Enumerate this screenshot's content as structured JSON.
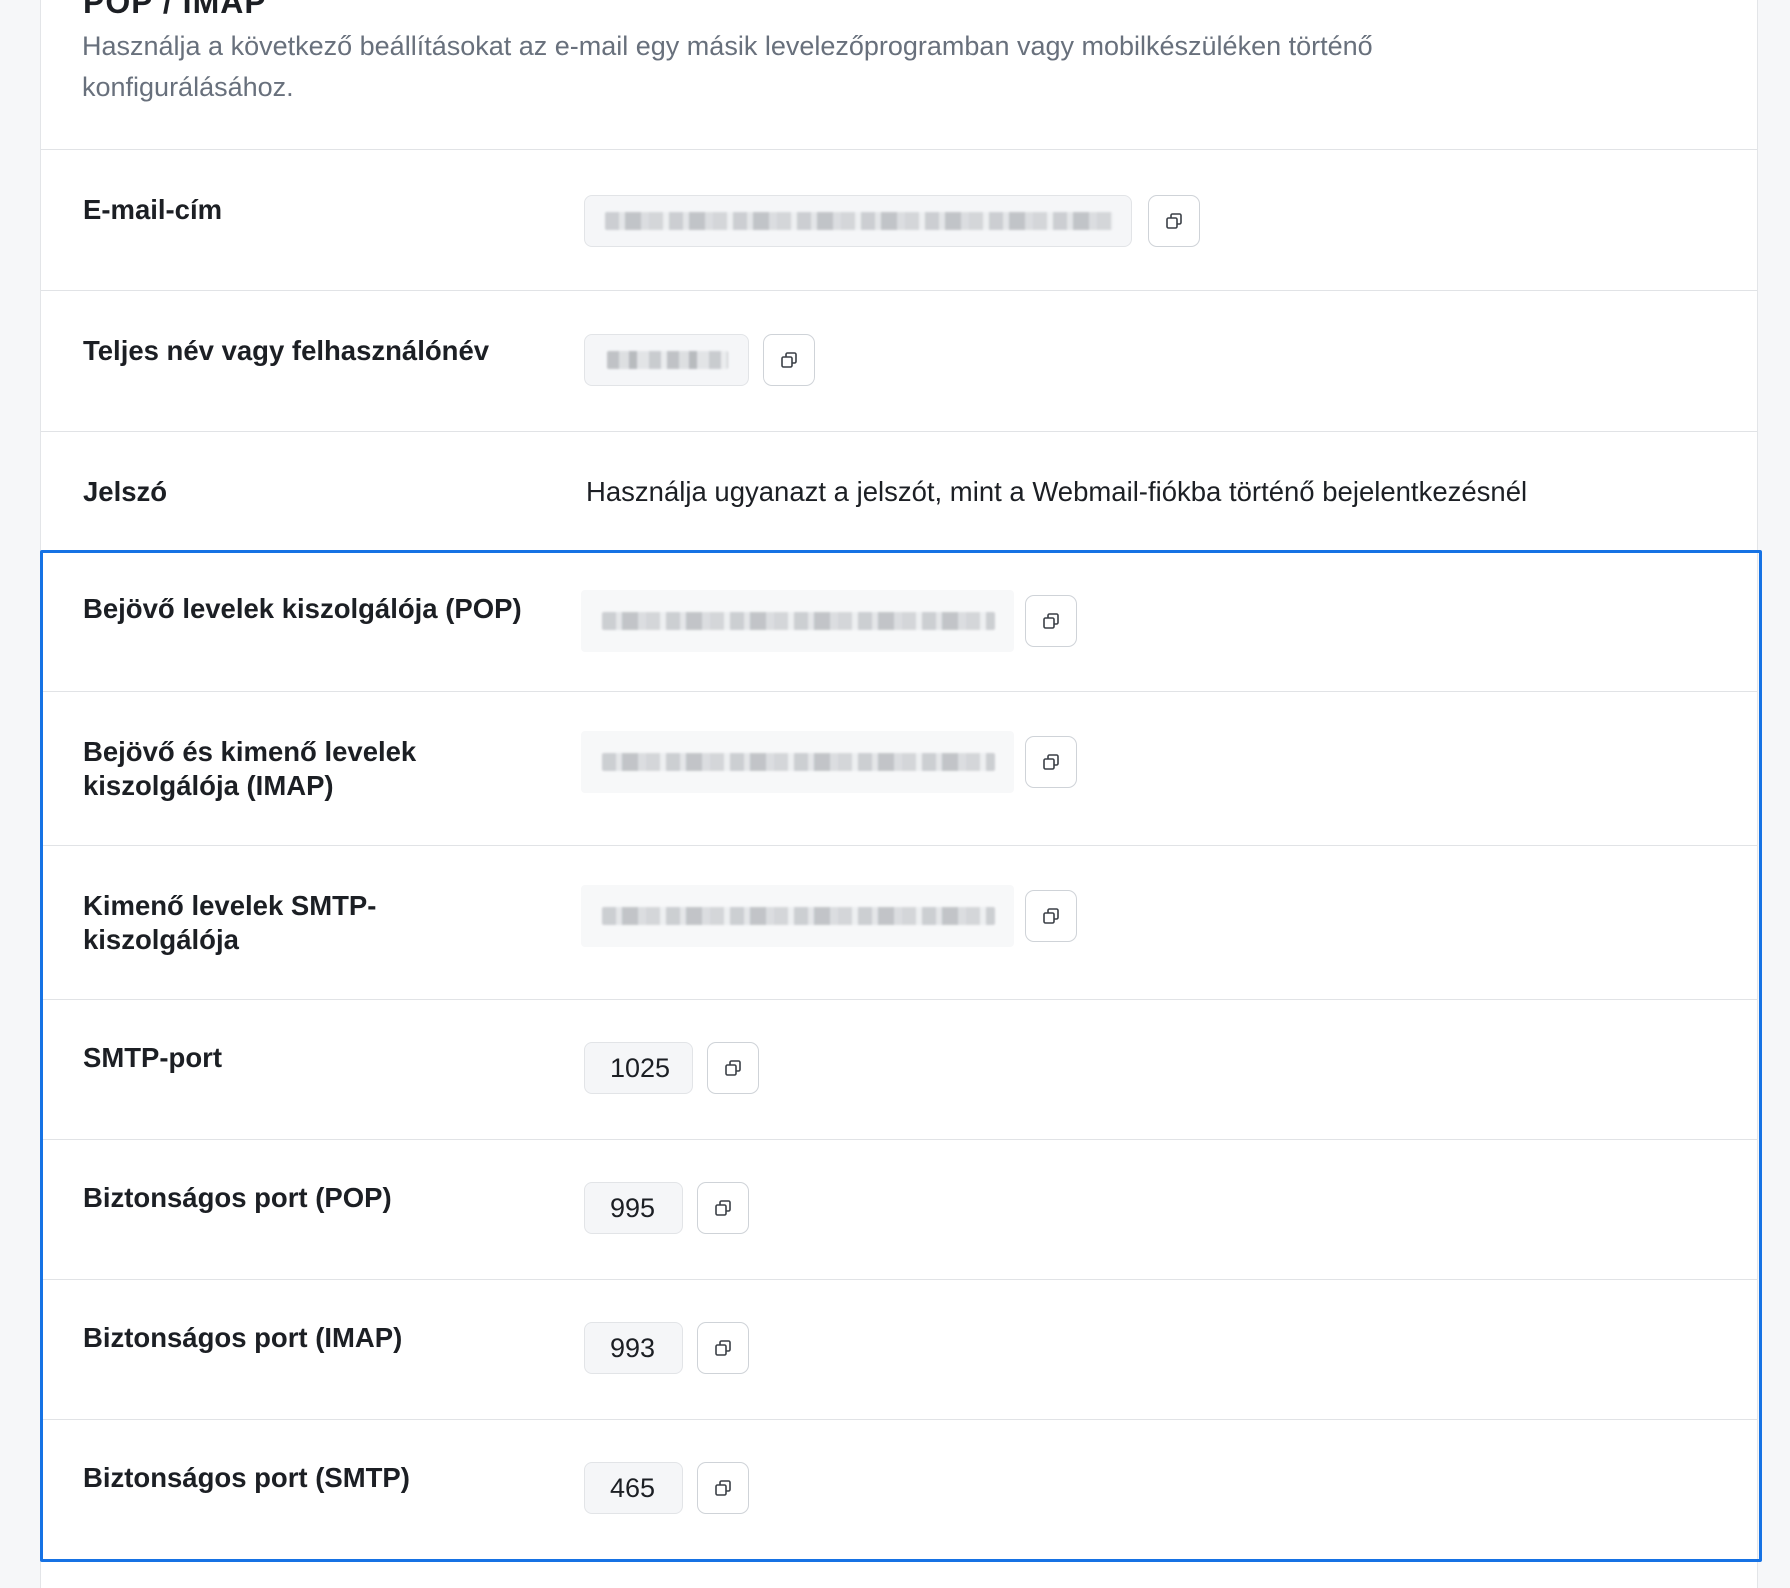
{
  "section": {
    "title_partial": "POP / IMAP",
    "description": "Használja a következő beállításokat az e-mail egy másik levelezőprogramban vagy mobilkészüléken történő konfigurálásához."
  },
  "rows": {
    "email": {
      "label": "E-mail-cím",
      "value": "",
      "copy_icon": "copy-icon"
    },
    "username": {
      "label": "Teljes név vagy felhasználónév",
      "value": "",
      "copy_icon": "copy-icon"
    },
    "password": {
      "label": "Jelszó",
      "text": "Használja ugyanazt a jelszót, mint a Webmail-fiókba történő bejelentkezésnél"
    },
    "pop_server": {
      "label": "Bejövő levelek kiszolgálója (POP)",
      "value": "",
      "copy_icon": "copy-icon"
    },
    "imap_server": {
      "label": "Bejövő és kimenő levelek kiszolgálója (IMAP)",
      "value": "",
      "copy_icon": "copy-icon"
    },
    "smtp_server": {
      "label": "Kimenő levelek SMTP-kiszolgálója",
      "value": "",
      "copy_icon": "copy-icon"
    },
    "smtp_port": {
      "label": "SMTP-port",
      "value": "1025",
      "copy_icon": "copy-icon"
    },
    "secure_pop": {
      "label": "Biztonságos port (POP)",
      "value": "995",
      "copy_icon": "copy-icon"
    },
    "secure_imap": {
      "label": "Biztonságos port (IMAP)",
      "value": "993",
      "copy_icon": "copy-icon"
    },
    "secure_smtp": {
      "label": "Biztonságos port (SMTP)",
      "value": "465",
      "copy_icon": "copy-icon"
    }
  },
  "colors": {
    "highlight_border": "#1672e4",
    "muted_text": "#68707c",
    "background": "#f6f7f9"
  }
}
